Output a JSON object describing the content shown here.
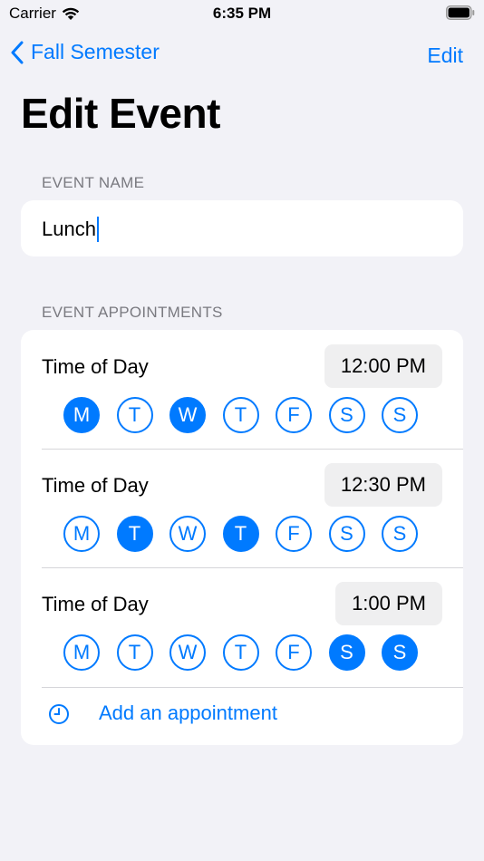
{
  "status_bar": {
    "carrier": "Carrier",
    "time": "6:35 PM"
  },
  "nav": {
    "back_label": "Fall Semester",
    "edit_label": "Edit"
  },
  "page_title": "Edit Event",
  "event_name": {
    "header": "EVENT NAME",
    "value": "Lunch"
  },
  "appointments": {
    "header": "EVENT APPOINTMENTS",
    "rows": [
      {
        "label": "Time of Day",
        "time": "12:00 PM",
        "days": [
          {
            "letter": "M",
            "selected": true
          },
          {
            "letter": "T",
            "selected": false
          },
          {
            "letter": "W",
            "selected": true
          },
          {
            "letter": "T",
            "selected": false
          },
          {
            "letter": "F",
            "selected": false
          },
          {
            "letter": "S",
            "selected": false
          },
          {
            "letter": "S",
            "selected": false
          }
        ]
      },
      {
        "label": "Time of Day",
        "time": "12:30 PM",
        "days": [
          {
            "letter": "M",
            "selected": false
          },
          {
            "letter": "T",
            "selected": true
          },
          {
            "letter": "W",
            "selected": false
          },
          {
            "letter": "T",
            "selected": true
          },
          {
            "letter": "F",
            "selected": false
          },
          {
            "letter": "S",
            "selected": false
          },
          {
            "letter": "S",
            "selected": false
          }
        ]
      },
      {
        "label": "Time of Day",
        "time": "1:00 PM",
        "days": [
          {
            "letter": "M",
            "selected": false
          },
          {
            "letter": "T",
            "selected": false
          },
          {
            "letter": "W",
            "selected": false
          },
          {
            "letter": "T",
            "selected": false
          },
          {
            "letter": "F",
            "selected": false
          },
          {
            "letter": "S",
            "selected": true
          },
          {
            "letter": "S",
            "selected": true
          }
        ]
      }
    ],
    "add_label": "Add an appointment",
    "add_icon": "clock-icon"
  },
  "colors": {
    "accent": "#007aff",
    "background": "#f2f2f7",
    "pill": "#efeff0"
  }
}
